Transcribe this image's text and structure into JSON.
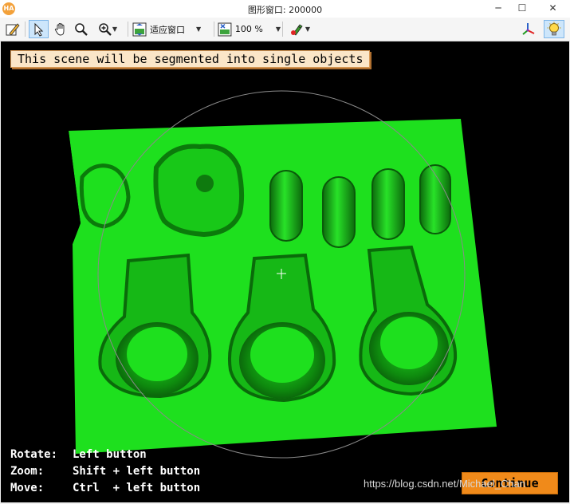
{
  "window": {
    "title": "图形窗口: 200000",
    "app_icon_text": "HA",
    "minimize_glyph": "─",
    "maximize_glyph": "☐",
    "close_glyph": "✕"
  },
  "toolbar": {
    "fit_label": "适应窗口",
    "zoom_label": "100 %",
    "icons": [
      "edit-icon",
      "pointer-icon",
      "hand-pan-icon",
      "magnifier-icon",
      "zoom-in-icon",
      "fit-window-icon",
      "zoom-percent-icon",
      "color-pen-icon",
      "axes-icon",
      "lightbulb-icon"
    ]
  },
  "canvas": {
    "message": "This scene will be segmented into single objects",
    "help": [
      {
        "key": "Rotate:",
        "value": "Left button"
      },
      {
        "key": "Zoom:",
        "value": "Shift + left button"
      },
      {
        "key": "Move:",
        "value": "Ctrl  + left button"
      }
    ],
    "continue_label": "Continue",
    "watermark": "https://blog.csdn.net/Michael_Chan",
    "object_color": "#1ee01e",
    "background_color": "#000000"
  }
}
